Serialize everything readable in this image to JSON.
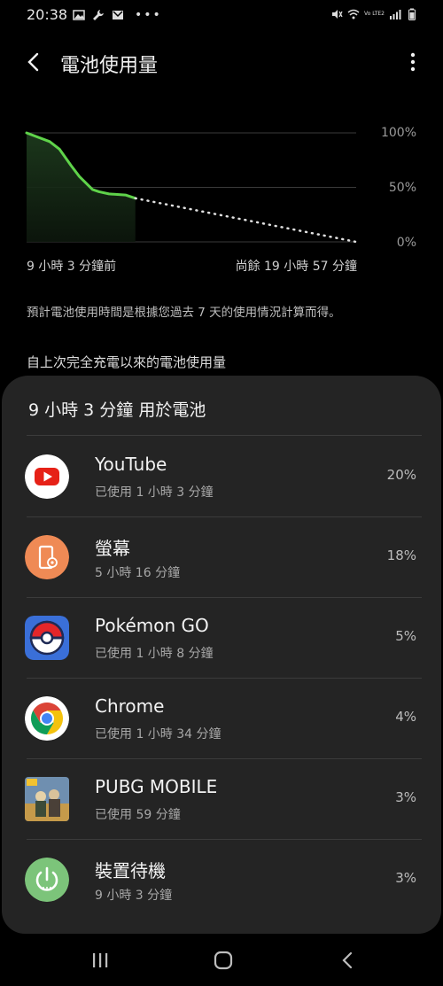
{
  "status_bar": {
    "time": "20:38",
    "left_icons": [
      "gallery-icon",
      "wrench-icon",
      "gmail-icon",
      "more-dots-icon"
    ],
    "right_icons": [
      "mute-icon",
      "wifi-icon",
      "lte-icon",
      "signal-icon",
      "battery-icon"
    ],
    "lte_label": "Vo LTE2"
  },
  "header": {
    "title": "電池使用量"
  },
  "chart_data": {
    "type": "line",
    "y_ticks": [
      "100%",
      "50%",
      "0%"
    ],
    "ylim": [
      0,
      100
    ],
    "x_start_label": "9 小時 3 分鐘前",
    "x_end_label": "尚餘 19 小時 57 分鐘",
    "series": [
      {
        "style": "solid",
        "color": "#5fd34a",
        "x": [
          0,
          0.07,
          0.1,
          0.135,
          0.16,
          0.2,
          0.22,
          0.25,
          0.3,
          0.33
        ],
        "y": [
          100,
          92,
          85,
          70,
          60,
          48,
          46,
          44,
          43,
          40
        ]
      },
      {
        "style": "dotted",
        "color": "#e0e0e0",
        "x": [
          0.33,
          1.0
        ],
        "y": [
          40,
          0
        ]
      }
    ]
  },
  "note": "預計電池使用時間是根據您過去 7 天的使用情況計算而得。",
  "section_title": "自上次完全充電以來的電池使用量",
  "card": {
    "title": "9 小時 3 分鐘 用於電池",
    "apps": [
      {
        "name": "YouTube",
        "sub": "已使用 1 小時 3 分鐘",
        "pct": "20%",
        "icon": "youtube-icon"
      },
      {
        "name": "螢幕",
        "sub": "5 小時 16 分鐘",
        "pct": "18%",
        "icon": "screen-icon"
      },
      {
        "name": "Pokémon GO",
        "sub": "已使用 1 小時 8 分鐘",
        "pct": "5%",
        "icon": "pokemon-go-icon"
      },
      {
        "name": "Chrome",
        "sub": "已使用 1 小時 34 分鐘",
        "pct": "4%",
        "icon": "chrome-icon"
      },
      {
        "name": "PUBG MOBILE",
        "sub": "已使用 59 分鐘",
        "pct": "3%",
        "icon": "pubg-icon"
      },
      {
        "name": "裝置待機",
        "sub": "9 小時 3 分鐘",
        "pct": "3%",
        "icon": "standby-power-icon"
      }
    ]
  },
  "nav_bar": {
    "buttons": [
      "recents-icon",
      "home-icon",
      "back-icon"
    ]
  },
  "colors": {
    "background": "#000000",
    "card": "#242424",
    "chart_line": "#5fd34a",
    "screen_icon_bg": "#ef8a55",
    "standby_icon_bg": "#7cc47a",
    "youtube_red": "#e62117"
  }
}
